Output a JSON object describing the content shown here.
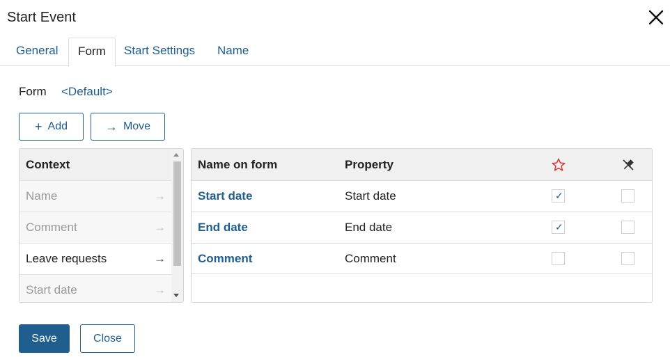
{
  "dialog": {
    "title": "Start Event"
  },
  "tabs": [
    {
      "label": "General"
    },
    {
      "label": "Form"
    },
    {
      "label": "Start Settings"
    },
    {
      "label": "Name"
    }
  ],
  "form": {
    "label": "Form",
    "value": "<Default>"
  },
  "toolbar": {
    "add_icon": "+",
    "add_label": "Add",
    "move_icon": "→",
    "move_label": "Move"
  },
  "context": {
    "header": "Context",
    "items": [
      {
        "label": "Name",
        "arrow": "→"
      },
      {
        "label": "Comment",
        "arrow": "→"
      },
      {
        "label": "Leave requests",
        "arrow": "→"
      },
      {
        "label": "Start date",
        "arrow": "→"
      }
    ]
  },
  "table": {
    "headers": {
      "name": "Name on form",
      "property": "Property",
      "required_icon": "star-outline-icon",
      "readonly_icon": "pin-off-icon"
    },
    "rows": [
      {
        "name": "Start date",
        "property": "Start date",
        "required": true,
        "readonly": false
      },
      {
        "name": "End date",
        "property": "End date",
        "required": true,
        "readonly": false
      },
      {
        "name": "Comment",
        "property": "Comment",
        "required": false,
        "readonly": false
      }
    ],
    "check_mark": "✓"
  },
  "footer": {
    "save_label": "Save",
    "close_label": "Close"
  },
  "colors": {
    "accent": "#1f5e8f",
    "star": "#d9342b",
    "header_bg": "#f0f0f0"
  }
}
